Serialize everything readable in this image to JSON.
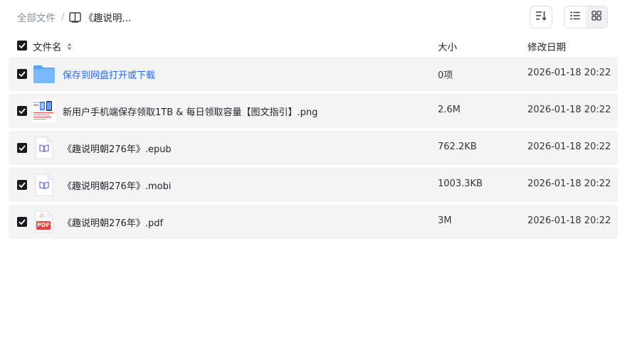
{
  "breadcrumb": {
    "root": "全部文件",
    "separator": "/",
    "current": "《趣说明..."
  },
  "toolbar": {
    "sort_icon": "sort-icon",
    "list_view_icon": "list-view-icon",
    "grid_view_icon": "grid-view-icon",
    "active_view": "list"
  },
  "table": {
    "columns": {
      "name": "文件名",
      "size": "大小",
      "modified": "修改日期"
    },
    "select_all_checked": true,
    "rows": [
      {
        "type": "folder",
        "icon": "folder-icon",
        "name": "保存到网盘打开或下载",
        "size": "0项",
        "modified": "2026-01-18 20:22",
        "checked": true
      },
      {
        "type": "image",
        "icon": "image-thumbnail",
        "name": "新用户手机端保存领取1TB & 每日领取容量【图文指引】.png",
        "size": "2.6M",
        "modified": "2026-01-18 20:22",
        "checked": true
      },
      {
        "type": "ebook",
        "icon": "ebook-icon",
        "name": "《趣说明朝276年》.epub",
        "size": "762.2KB",
        "modified": "2026-01-18 20:22",
        "checked": true
      },
      {
        "type": "ebook",
        "icon": "ebook-icon",
        "name": "《趣说明朝276年》.mobi",
        "size": "1003.3KB",
        "modified": "2026-01-18 20:22",
        "checked": true
      },
      {
        "type": "pdf",
        "icon": "pdf-icon",
        "name": "《趣说明朝276年》.pdf",
        "size": "3M",
        "modified": "2026-01-18 20:22",
        "checked": true,
        "icon_text": "PDF"
      }
    ]
  },
  "colors": {
    "accent": "#2468f2",
    "row_bg": "#f4f4f5",
    "checkbox": "#191a1f",
    "pdf_red": "#e8413c",
    "ebook_purple": "#7b7fd9"
  }
}
